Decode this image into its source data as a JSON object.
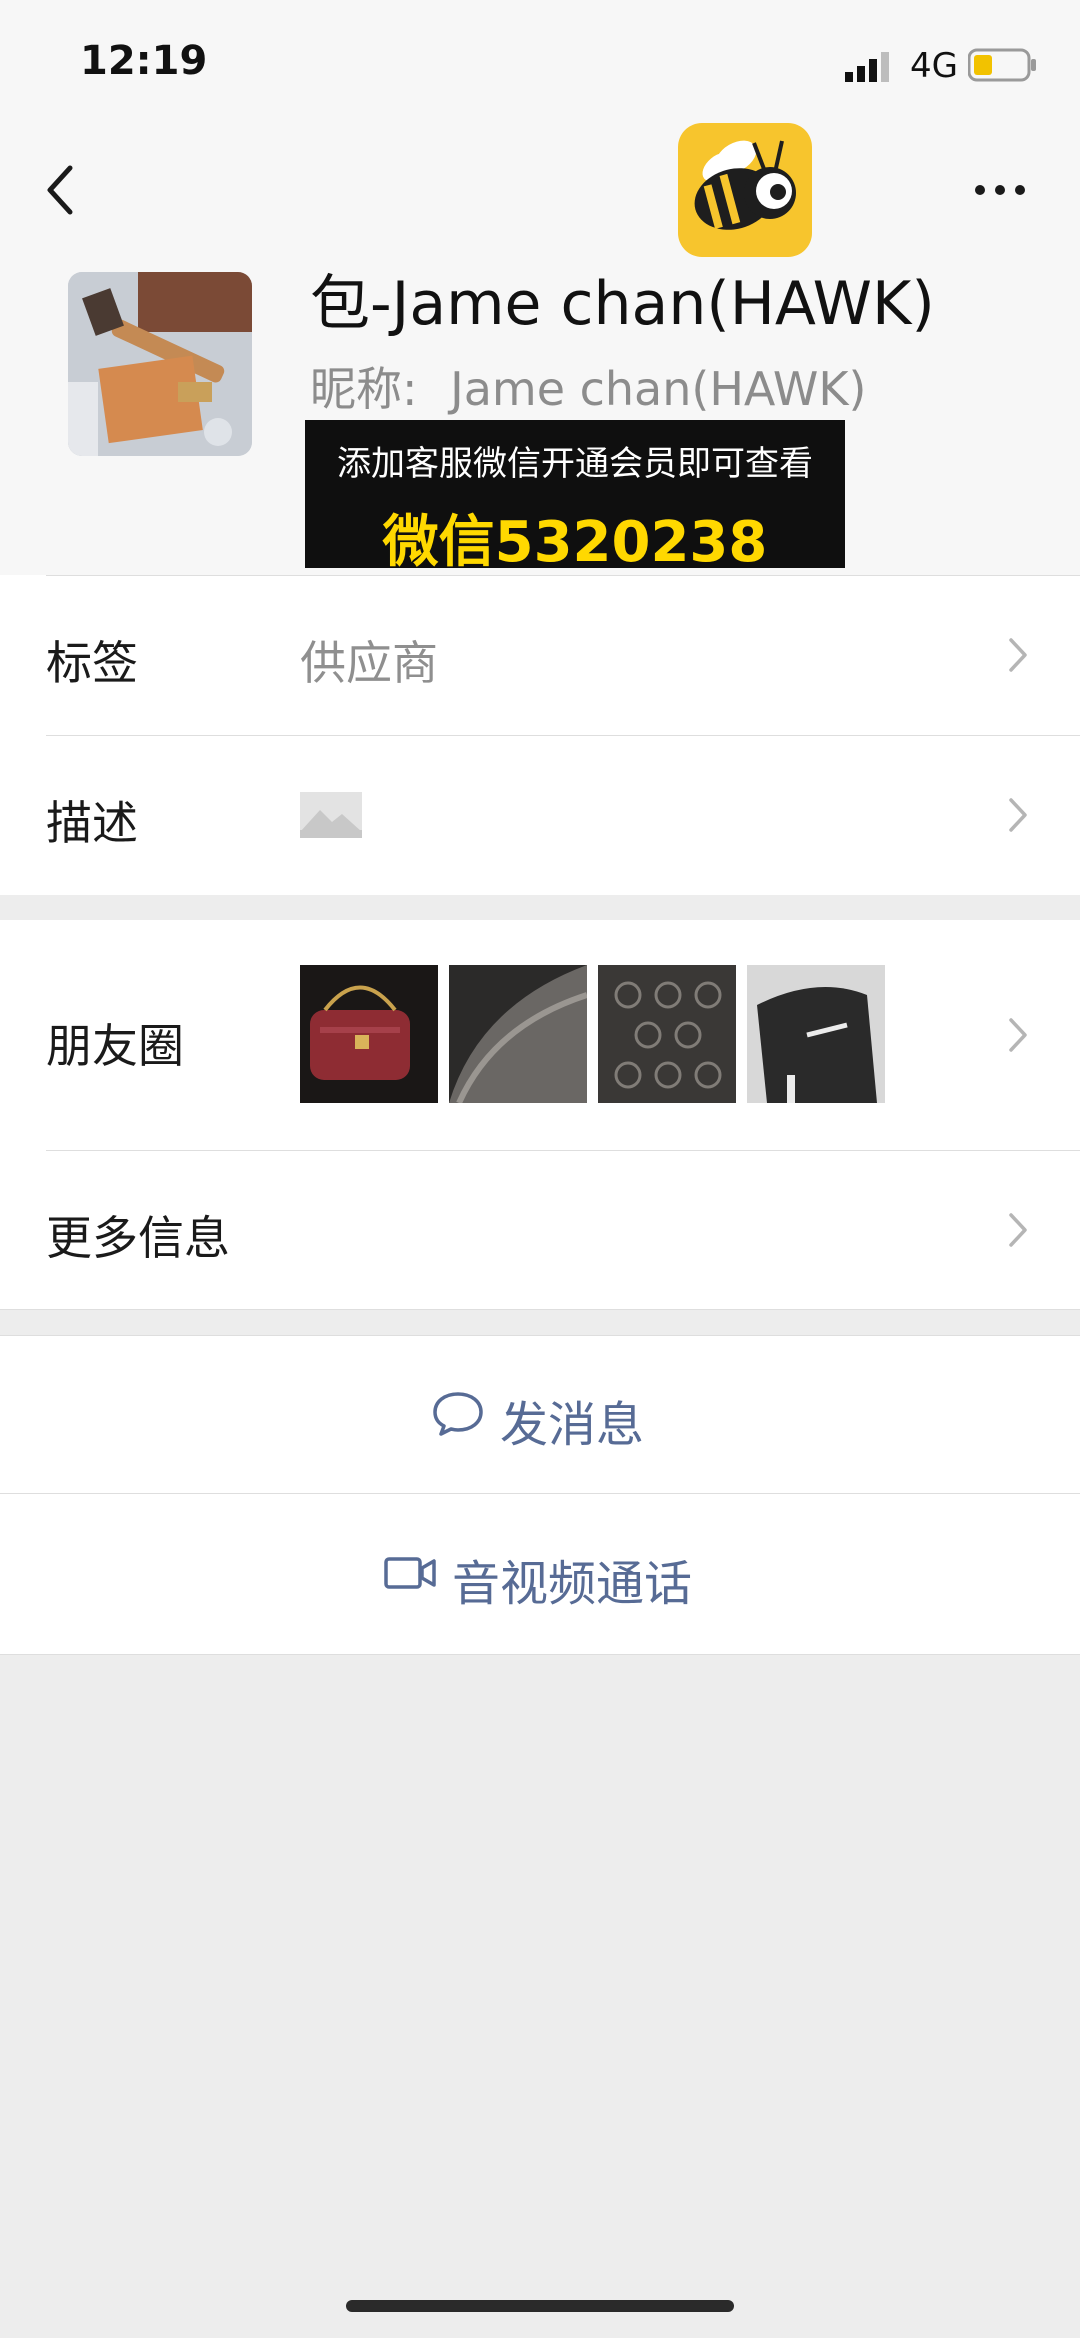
{
  "status_bar": {
    "time": "12:19",
    "network": "4G"
  },
  "profile": {
    "name": "包-Jame chan(HAWK)",
    "nickname_label": "昵称:",
    "nickname": "Jame chan(HAWK)"
  },
  "promo": {
    "line1": "添加客服微信开通会员即可查看",
    "line2": "微信5320238"
  },
  "rows": {
    "tags": {
      "label": "标签",
      "value": "供应商"
    },
    "description": {
      "label": "描述"
    },
    "moments": {
      "label": "朋友圈"
    },
    "more_info": {
      "label": "更多信息"
    }
  },
  "actions": {
    "send_message": "发消息",
    "av_call": "音视频通话"
  },
  "colors": {
    "link_blue": "#576b95",
    "promo_yellow": "#ffd800",
    "bee_yellow": "#f7c52d",
    "page_gray": "#ededed"
  },
  "icons": [
    "back-icon",
    "more-icon",
    "bee-logo",
    "image-placeholder-icon",
    "chevron-right-icon",
    "chat-bubble-icon",
    "video-camera-icon"
  ]
}
